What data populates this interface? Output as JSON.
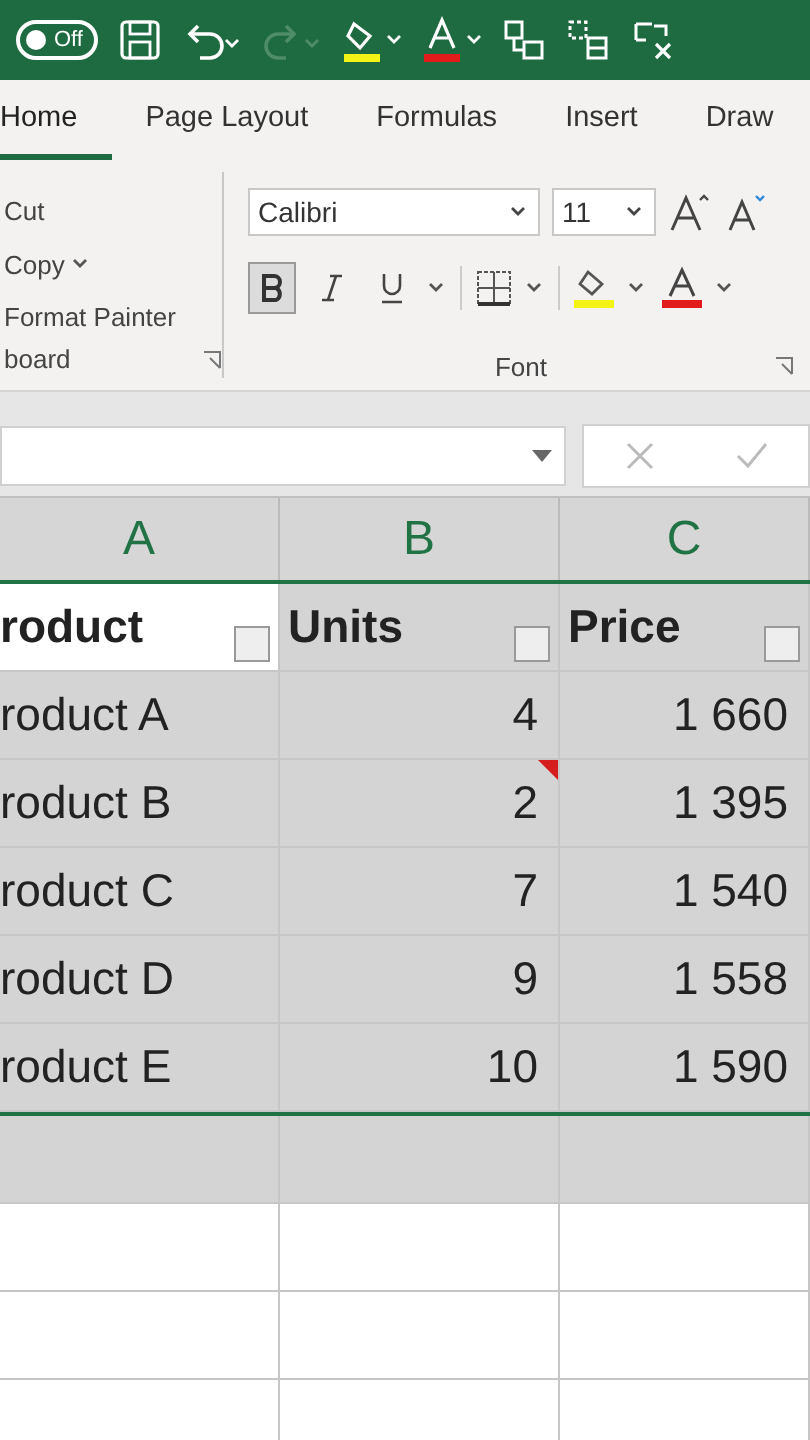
{
  "title_bar": {
    "autosave": {
      "label": "Off",
      "on": false
    },
    "redo_disabled": true
  },
  "tabs": [
    {
      "label": "Home",
      "selected": true
    },
    {
      "label": "Page Layout",
      "selected": false
    },
    {
      "label": "Formulas",
      "selected": false
    },
    {
      "label": "Insert",
      "selected": false
    },
    {
      "label": "Draw",
      "selected": false
    }
  ],
  "clipboard_group": {
    "items": [
      "Cut",
      "Copy",
      "Format Painter"
    ],
    "label": "board"
  },
  "font_group": {
    "font": "Calibri",
    "size": "11",
    "bold": true,
    "italic": false,
    "underline": false,
    "label": "Font"
  },
  "formula_bar": {
    "cancel_disabled": true
  },
  "columns": [
    {
      "label": "A"
    },
    {
      "label": "B"
    },
    {
      "label": "C"
    }
  ],
  "header_row": {
    "selected": true,
    "cells": [
      {
        "text": "roduct",
        "active": true
      },
      {
        "text": "Units",
        "active": false
      },
      {
        "text": "Price",
        "active": false
      }
    ]
  },
  "rows": [
    {
      "product": "roduct A",
      "units": "4",
      "price": "1 660",
      "comment": false,
      "selected": true
    },
    {
      "product": "roduct B",
      "units": "2",
      "price": "1 395",
      "comment": true,
      "selected": true
    },
    {
      "product": "roduct C",
      "units": "7",
      "price": "1 540",
      "comment": false,
      "selected": true
    },
    {
      "product": "roduct D",
      "units": "9",
      "price": "1 558",
      "comment": false,
      "selected": true
    },
    {
      "product": "roduct E",
      "units": "10",
      "price": "1 590",
      "comment": false,
      "selected": true
    }
  ],
  "blank_rows": [
    {
      "selected": true
    },
    {
      "selected": false
    },
    {
      "selected": false
    },
    {
      "selected": false
    }
  ]
}
